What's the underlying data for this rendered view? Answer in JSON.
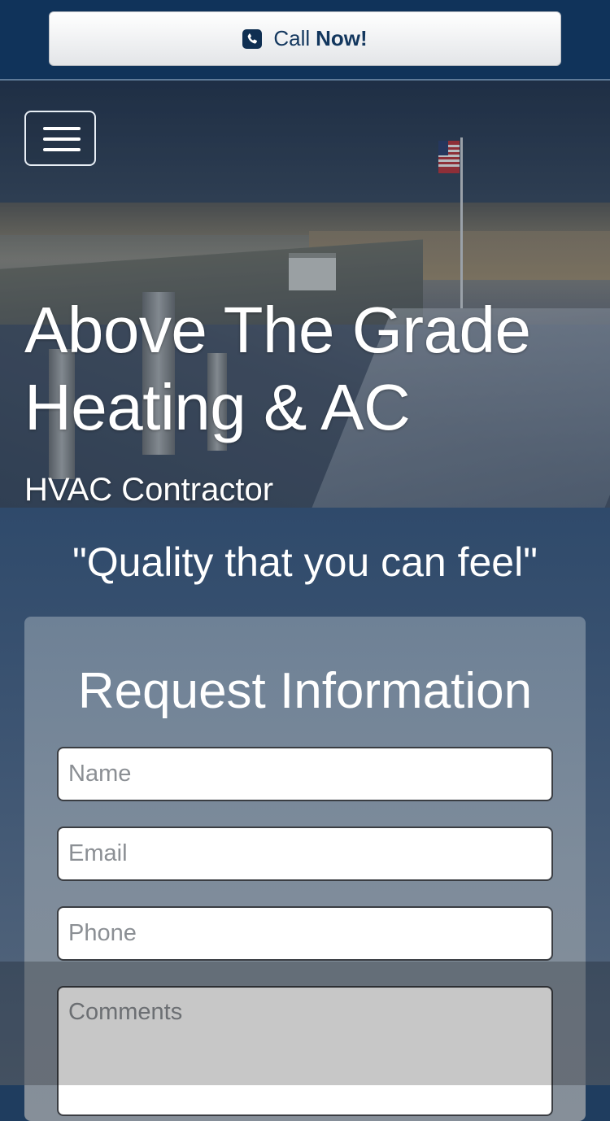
{
  "topbar": {
    "call_label": "Call",
    "call_label_bold": "Now!",
    "icon": "phone-icon",
    "color": "#10335a"
  },
  "hero": {
    "menu_icon": "hamburger-menu-icon",
    "title_line1": "Above The Grade",
    "title_line2": "Heating & AC",
    "subtitle": "HVAC Contractor"
  },
  "tagline": "\"Quality that you can feel\"",
  "form": {
    "title": "Request Information",
    "name_placeholder": "Name",
    "email_placeholder": "Email",
    "phone_placeholder": "Phone",
    "comments_placeholder": "Comments"
  }
}
